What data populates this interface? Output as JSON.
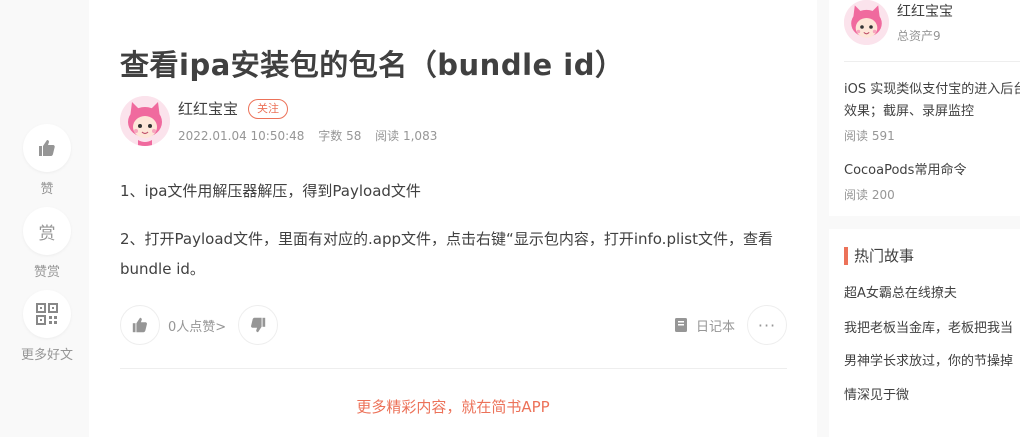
{
  "sidebar": {
    "like_label": "赞",
    "reward_label": "赞赏",
    "reward_glyph": "赏",
    "more_label": "更多好文"
  },
  "article": {
    "title": "查看ipa安装包的包名（bundle id）",
    "author": "红红宝宝",
    "follow_label": "关注",
    "date": "2022.01.04 10:50:48",
    "word_count": "字数 58",
    "read_count": "阅读 1,083",
    "paragraphs": [
      "1、ipa文件用解压器解压，得到Payload文件",
      "2、打开Payload文件，里面有对应的.app文件，点击右键“显示包内容，打开info.plist文件，查看bundle id。"
    ],
    "like_count_label": "0人点赞",
    "like_chevron": ">",
    "notebook_label": "日记本",
    "more_dots": "···",
    "app_promo": "更多精彩内容，就在简书APP"
  },
  "right_sidebar": {
    "author_name": "红红宝宝",
    "assets": "总资产9",
    "posts": [
      {
        "title_line1": "iOS 实现类似支付宝的进入后台",
        "title_line2": "效果；截屏、录屏监控",
        "reads": "阅读 591"
      },
      {
        "title_line1": "CocoaPods常用命令",
        "title_line2": "",
        "reads": "阅读 200"
      }
    ],
    "hot_title": "热门故事",
    "hot_items": [
      "超A女霸总在线撩夫",
      "我把老板当金库，老板把我当",
      "男神学长求放过，你的节操掉",
      "情深见于微"
    ]
  },
  "colors": {
    "accent": "#ec7259",
    "text": "#404040",
    "muted": "#969696",
    "background": "#f9f9f9"
  }
}
